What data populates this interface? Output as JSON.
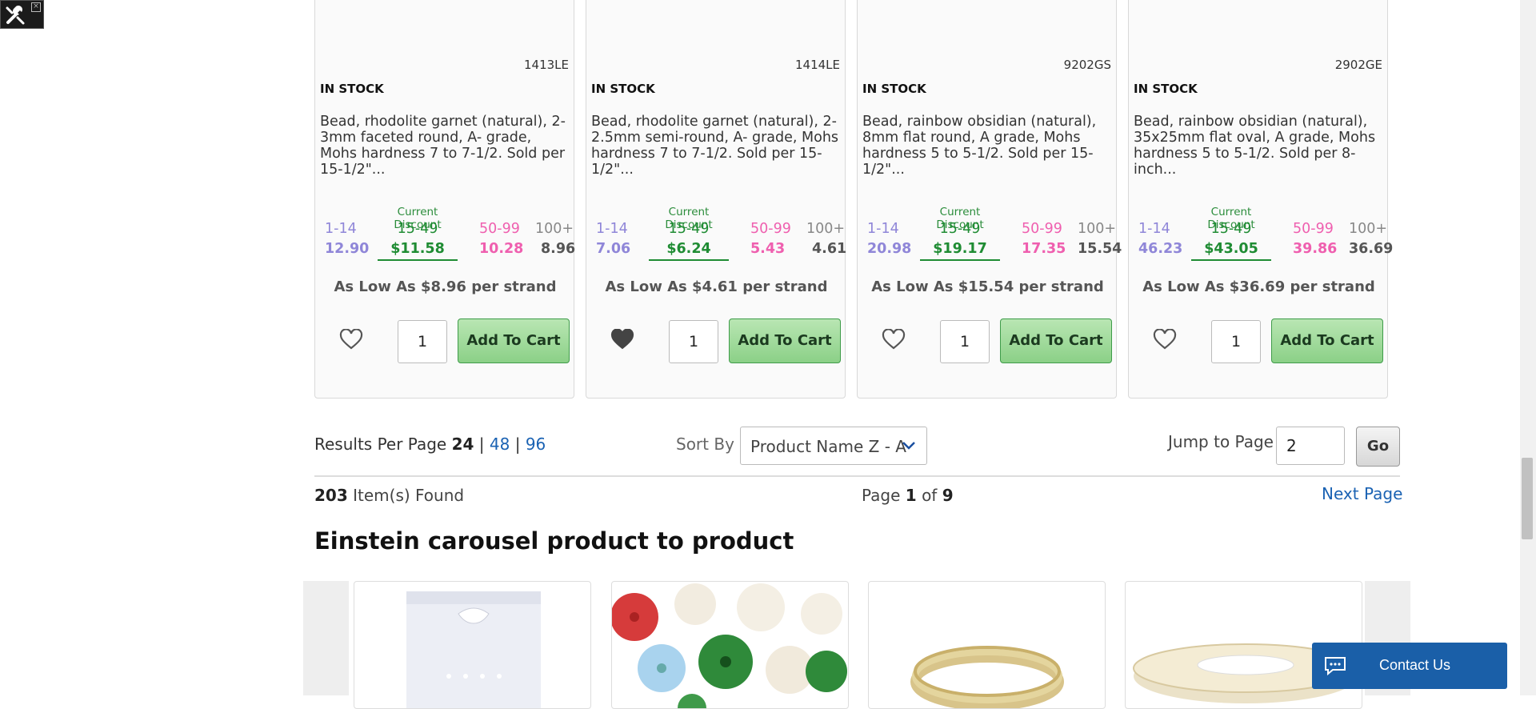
{
  "products": [
    {
      "sku": "1413LE",
      "stock": "IN STOCK",
      "description": "Bead, rhodolite garnet (natural), 2-3mm faceted round, A- grade, Mohs hardness 7 to 7-1/2. Sold per 15-1/2\"...",
      "discount_label": "Current Discount",
      "tiers": [
        "1-14",
        "15-49",
        "50-99",
        "100+"
      ],
      "prices": [
        "12.90",
        "$11.58",
        "10.28",
        "8.96"
      ],
      "low": "As Low As $8.96 per strand",
      "favorited": false,
      "qty": "1",
      "cart_label": "Add To Cart"
    },
    {
      "sku": "1414LE",
      "stock": "IN STOCK",
      "description": "Bead, rhodolite garnet (natural), 2-2.5mm semi-round, A- grade, Mohs hardness 7 to 7-1/2. Sold per 15-1/2\"...",
      "discount_label": "Current Discount",
      "tiers": [
        "1-14",
        "15-49",
        "50-99",
        "100+"
      ],
      "prices": [
        "7.06",
        "$6.24",
        "5.43",
        "4.61"
      ],
      "low": "As Low As $4.61 per strand",
      "favorited": true,
      "qty": "1",
      "cart_label": "Add To Cart"
    },
    {
      "sku": "9202GS",
      "stock": "IN STOCK",
      "description": "Bead, rainbow obsidian (natural), 8mm flat round, A grade, Mohs hardness 5 to 5-1/2. Sold per 15-1/2\"...",
      "discount_label": "Current Discount",
      "tiers": [
        "1-14",
        "15-49",
        "50-99",
        "100+"
      ],
      "prices": [
        "20.98",
        "$19.17",
        "17.35",
        "15.54"
      ],
      "low": "As Low As $15.54 per strand",
      "favorited": false,
      "qty": "1",
      "cart_label": "Add To Cart"
    },
    {
      "sku": "2902GE",
      "stock": "IN STOCK",
      "description": "Bead, rainbow obsidian (natural), 35x25mm flat oval, A grade, Mohs hardness 5 to 5-1/2. Sold per 8-inch...",
      "discount_label": "Current Discount",
      "tiers": [
        "1-14",
        "15-49",
        "50-99",
        "100+"
      ],
      "prices": [
        "46.23",
        "$43.05",
        "39.86",
        "36.69"
      ],
      "low": "As Low As $36.69 per strand",
      "favorited": false,
      "qty": "1",
      "cart_label": "Add To Cart"
    }
  ],
  "results": {
    "label": "Results Per Page",
    "current": "24",
    "option_48": "48",
    "option_96": "96",
    "sep": "|"
  },
  "sort": {
    "label": "Sort By",
    "value": "Product Name Z - A"
  },
  "jump": {
    "label": "Jump to Page",
    "value": "2",
    "go": "Go"
  },
  "summary": {
    "count": "203",
    "count_suffix": "Item(s) Found",
    "page_prefix": "Page",
    "page": "1",
    "of": "of",
    "total_pages": "9",
    "next": "Next Page"
  },
  "carousel": {
    "title": "Einstein carousel product to product"
  },
  "contact": {
    "label": "Contact Us"
  },
  "colors": {
    "tier1": "#8f86d8",
    "current": "#1f8c33",
    "tier3": "#ef5faf",
    "cart_button": "#8bd087",
    "link": "#1a62b3",
    "contact_bg": "#1a5fa8"
  }
}
